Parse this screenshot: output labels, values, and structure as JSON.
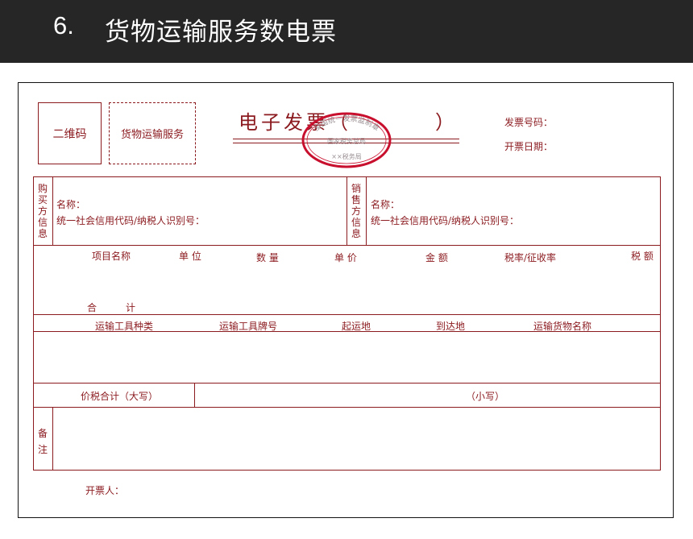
{
  "header": {
    "number": "6.",
    "title": "货物运输服务数电票"
  },
  "invoice": {
    "qr_label": "二维码",
    "service_label": "货物运输服务",
    "title": "电子发票（",
    "title_close": "）",
    "seal": {
      "top_text": "全国统一发票监制章",
      "middle_text": "国家税务总局",
      "bottom_text": "××税务局"
    },
    "invoice_number_label": "发票号码：",
    "issue_date_label": "开票日期：",
    "buyer": {
      "side_label": [
        "购",
        "买",
        "方",
        "信",
        "息"
      ],
      "name_label": "名称：",
      "id_label": "统一社会信用代码/纳税人识别号："
    },
    "seller": {
      "side_label": [
        "销",
        "售",
        "方",
        "信",
        "息"
      ],
      "name_label": "名称：",
      "id_label": "统一社会信用代码/纳税人识别号："
    },
    "item_columns": [
      "项目名称",
      "单 位",
      "数 量",
      "单 价",
      "金 额",
      "税率/征收率",
      "税 额"
    ],
    "total_label": "合　　　计",
    "transport_columns": [
      "运输工具种类",
      "运输工具牌号",
      "起运地",
      "到达地",
      "运输货物名称"
    ],
    "price_tax_total_upper": "价税合计（大写）",
    "price_tax_total_lower": "（小写）",
    "remarks_label": [
      "备",
      "注"
    ],
    "issuer_label": "开票人："
  },
  "colors": {
    "ink": "#8b1a1f",
    "seal": "#c8102e",
    "header_bg": "#262626"
  }
}
